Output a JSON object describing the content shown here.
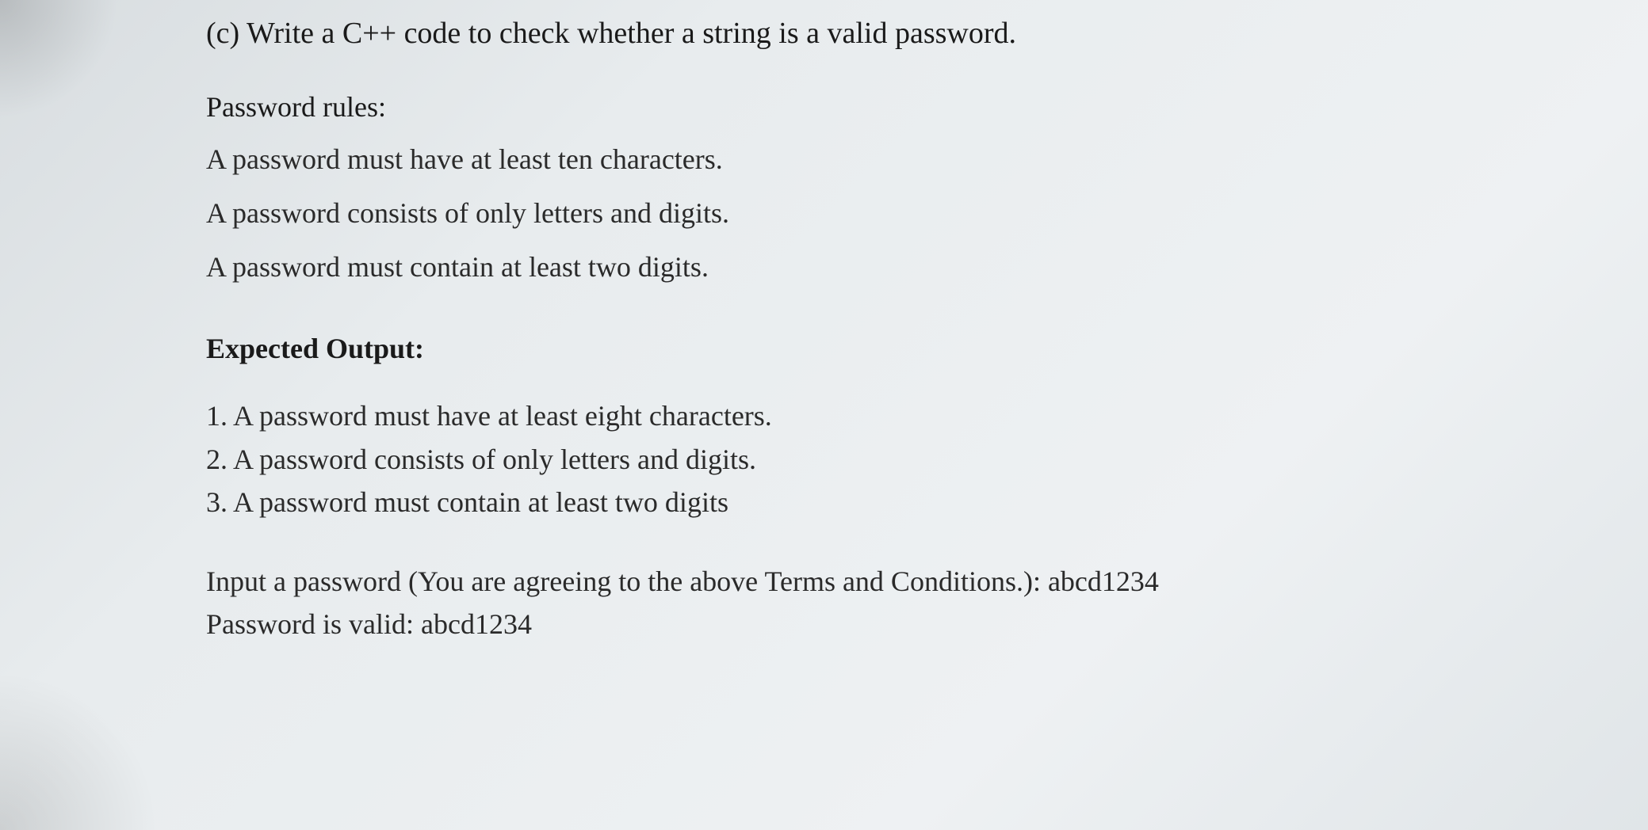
{
  "question": {
    "label": "(c)",
    "text": "Write a C++ code to check whether a string is a valid password."
  },
  "rules": {
    "header": "Password rules:",
    "items": [
      "A password must have at least ten characters.",
      "A password consists of only letters and digits.",
      "A password must contain at least two digits."
    ]
  },
  "expected": {
    "header": "Expected Output:",
    "items": [
      "1. A password must have at least eight characters.",
      "2. A password consists of only letters and digits.",
      "3. A password must contain at least two digits"
    ]
  },
  "sample": {
    "prompt": "Input a password (You are agreeing to the above Terms and Conditions.): abcd1234",
    "result": "Password is valid: abcd1234"
  }
}
